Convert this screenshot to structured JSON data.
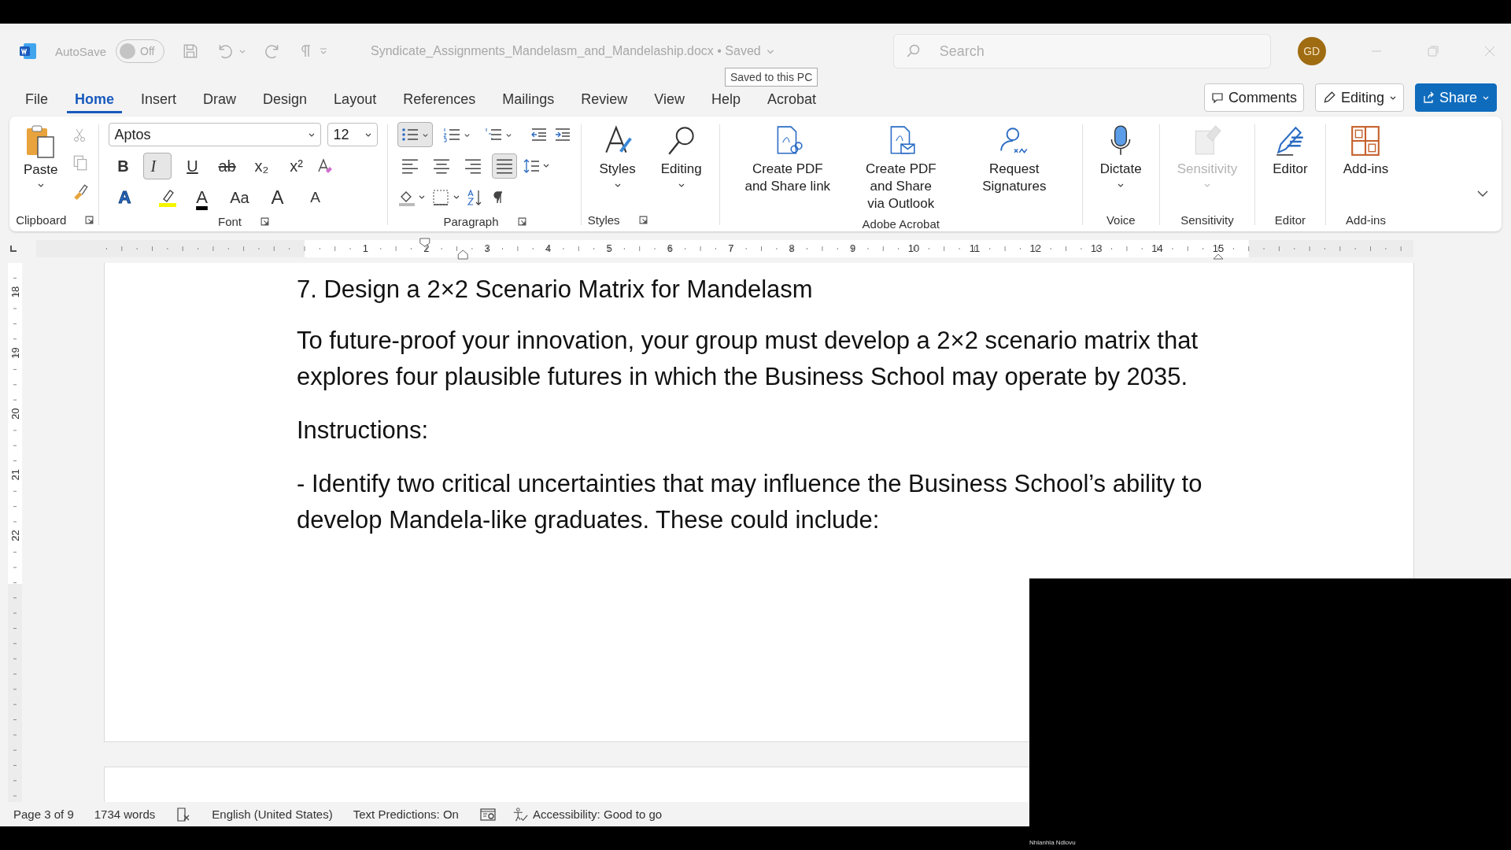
{
  "title_bar": {
    "autosave_label": "AutoSave",
    "autosave": {
      "label": "Off",
      "on": false
    },
    "document_title": "Syndicate_Assignments_Mandelasm_and_Mandelaship.docx • Saved",
    "tooltip": "Saved to this PC",
    "search": {
      "placeholder": "Search"
    },
    "avatar": "GD"
  },
  "menu_tabs": [
    {
      "label": "File",
      "selected": false
    },
    {
      "label": "Home",
      "selected": true
    },
    {
      "label": "Insert",
      "selected": false
    },
    {
      "label": "Draw",
      "selected": false
    },
    {
      "label": "Design",
      "selected": false
    },
    {
      "label": "Layout",
      "selected": false
    },
    {
      "label": "References",
      "selected": false
    },
    {
      "label": "Mailings",
      "selected": false
    },
    {
      "label": "Review",
      "selected": false
    },
    {
      "label": "View",
      "selected": false
    },
    {
      "label": "Help",
      "selected": false
    },
    {
      "label": "Acrobat",
      "selected": false
    }
  ],
  "actions": {
    "comments": "Comments",
    "editing": "Editing",
    "share": "Share"
  },
  "ribbon": {
    "clipboard": {
      "paste": "Paste",
      "label": "Clipboard",
      "launcher": true
    },
    "font": {
      "name": "Aptos",
      "size": "12",
      "label": "Font",
      "launcher": true,
      "format_buttons": [
        {
          "glyph": "B",
          "kind": "bold",
          "active": false
        },
        {
          "glyph": "I",
          "kind": "italic",
          "active": true
        },
        {
          "glyph": "U",
          "kind": "underline",
          "active": false
        },
        {
          "glyph": "ab",
          "kind": "strike",
          "active": false
        },
        {
          "glyph": "x₂",
          "kind": "plain",
          "active": false
        },
        {
          "glyph": "x²",
          "kind": "plain",
          "active": false
        }
      ],
      "row3": [
        {
          "glyph": "A",
          "kind": "effects"
        },
        {
          "glyph": "A",
          "kind": "color"
        },
        {
          "glyph": "Aa",
          "kind": "case"
        },
        {
          "glyph": "A",
          "kind": "grow"
        },
        {
          "glyph": "A",
          "kind": "shrink"
        }
      ]
    },
    "paragraph": {
      "label": "Paragraph",
      "launcher": true,
      "list_buttons": [
        {
          "kind": "bullets",
          "active": true
        },
        {
          "kind": "numbering",
          "active": false
        },
        {
          "kind": "multilevel",
          "active": false
        }
      ],
      "alignments": [
        {
          "kind": "left",
          "selected": false
        },
        {
          "kind": "center",
          "selected": false
        },
        {
          "kind": "right",
          "selected": false
        },
        {
          "kind": "justify",
          "selected": true
        }
      ]
    },
    "large_groups": [
      {
        "label": "Styles",
        "launcher": true,
        "buttons": [
          {
            "label": "Styles",
            "dropdown": true,
            "disabled": false
          }
        ]
      },
      {
        "buttons": [
          {
            "label": "Editing",
            "dropdown": true,
            "disabled": false
          }
        ]
      },
      {
        "label": "Adobe Acrobat",
        "launcher": false,
        "buttons": [
          {
            "label": "Create PDF and Share link",
            "dropdown": false,
            "disabled": false
          },
          {
            "label": "Create PDF and Share via Outlook",
            "dropdown": false,
            "disabled": false
          },
          {
            "label": "Request Signatures",
            "dropdown": false,
            "disabled": false
          }
        ]
      },
      {
        "label": "Voice",
        "launcher": false,
        "buttons": [
          {
            "label": "Dictate",
            "dropdown": true,
            "disabled": false
          }
        ]
      },
      {
        "label": "Sensitivity",
        "launcher": false,
        "buttons": [
          {
            "label": "Sensitivity",
            "dropdown": true,
            "disabled": true
          }
        ]
      },
      {
        "label": "Editor",
        "launcher": false,
        "buttons": [
          {
            "label": "Editor",
            "dropdown": false,
            "disabled": false
          }
        ]
      },
      {
        "label": "Add-ins",
        "launcher": false,
        "buttons": [
          {
            "label": "Add-ins",
            "dropdown": false,
            "disabled": false
          }
        ]
      }
    ]
  },
  "ruler": {
    "numbers": [
      "1",
      "2",
      "3",
      "4",
      "5",
      "6",
      "7",
      "8",
      "9",
      "10",
      "11",
      "12",
      "13",
      "14",
      "15"
    ]
  },
  "vertical_ruler": {
    "numbers": [
      "18",
      "19",
      "20",
      "21",
      "22"
    ]
  },
  "document": {
    "heading": "7. Design a 2×2 Scenario Matrix for Mandelasm",
    "paragraphs": [
      "To future-proof your innovation, your group must develop a 2×2 scenario matrix that explores four plausible futures in which the Business School may operate by 2035.",
      "Instructions:",
      "- Identify two critical uncertainties that may influence the Business School’s ability to develop Mandela-like graduates. These could include:"
    ]
  },
  "status_bar": {
    "page": "Page 3 of 9",
    "words": "1734 words",
    "language": "English (United States)",
    "predictions": "Text Predictions: On",
    "accessibility": "Accessibility: Good to go"
  },
  "presenter_name": "Nhlanhla Ndlovu"
}
